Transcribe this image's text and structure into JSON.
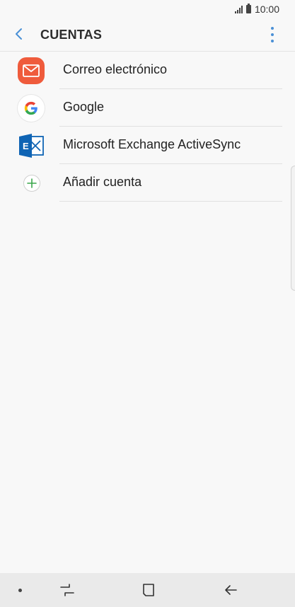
{
  "status_bar": {
    "time": "10:00",
    "icons": [
      "signal-icon",
      "battery-icon"
    ]
  },
  "header": {
    "title": "CUENTAS",
    "back_icon": "back-arrow-icon",
    "menu_icon": "more-vert-icon"
  },
  "accounts": [
    {
      "label": "Correo electrónico",
      "icon": "email-icon"
    },
    {
      "label": "Google",
      "icon": "google-icon"
    },
    {
      "label": "Microsoft Exchange ActiveSync",
      "icon": "exchange-icon"
    },
    {
      "label": "Añadir cuenta",
      "icon": "add-icon"
    }
  ],
  "nav_bar": {
    "icons": [
      "nav-dot-icon",
      "recent-apps-icon",
      "home-icon",
      "back-icon"
    ]
  },
  "colors": {
    "accent": "#4a90d6",
    "email": "#ef5b3c",
    "exchange": "#0f64b4",
    "add": "#3aa64a"
  }
}
